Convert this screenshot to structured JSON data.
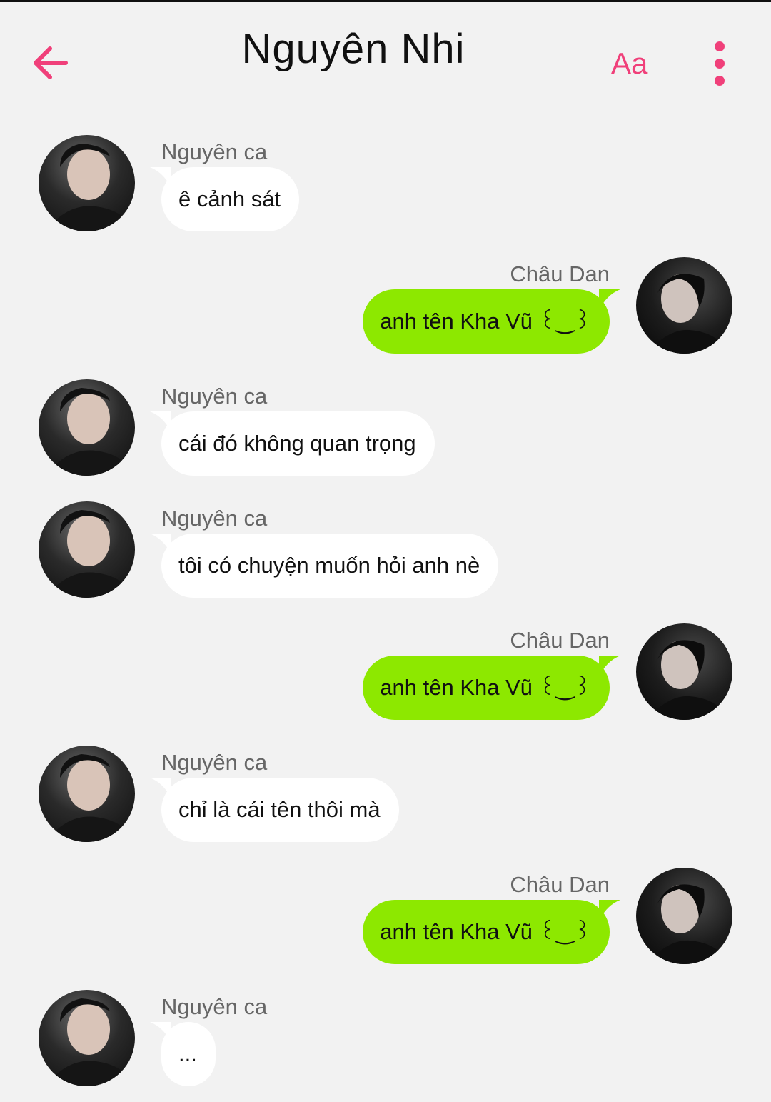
{
  "header": {
    "title": "Nguyên Nhi",
    "font_label": "Aa",
    "back_icon": "arrow-left-icon",
    "more_icon": "more-vertical-icon"
  },
  "colors": {
    "accent": "#f0407a",
    "background": "#f2f2f2",
    "incoming_bubble": "#ffffff",
    "outgoing_bubble": "#8de800"
  },
  "messages": [
    {
      "sender": "Nguyên ca",
      "text": "ê cảnh sát",
      "side": "left"
    },
    {
      "sender": "Châu Dan",
      "text": "anh tên Kha Vũ ꒰‿꒱",
      "side": "right"
    },
    {
      "sender": "Nguyên ca",
      "text": "cái đó không quan trọng",
      "side": "left"
    },
    {
      "sender": "Nguyên ca",
      "text": "tôi có chuyện muốn hỏi anh nè",
      "side": "left"
    },
    {
      "sender": "Châu Dan",
      "text": "anh tên Kha Vũ ꒰‿꒱",
      "side": "right"
    },
    {
      "sender": "Nguyên ca",
      "text": "chỉ là cái tên thôi mà",
      "side": "left"
    },
    {
      "sender": "Châu Dan",
      "text": "anh tên Kha Vũ ꒰‿꒱",
      "side": "right"
    },
    {
      "sender": "Nguyên ca",
      "text": "...",
      "side": "left"
    }
  ]
}
